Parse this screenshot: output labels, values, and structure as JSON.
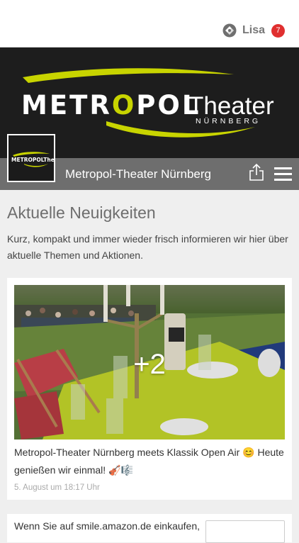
{
  "header": {
    "user_name": "Lisa",
    "notification_count": "7"
  },
  "page": {
    "name": "Metropol-Theater Nürnberg",
    "logo_primary": "METROPOLTheater",
    "logo_metro": "METR",
    "logo_o": "O",
    "logo_pol": "POL",
    "logo_theater": "Theater",
    "logo_city": "NÜRNBERG"
  },
  "section": {
    "title": "Aktuelle Neuigkeiten",
    "description": "Kurz, kompakt und immer wieder frisch informieren wir hier über aktuelle Themen und Aktionen."
  },
  "post": {
    "more_photos": "+2",
    "text": "Metropol-Theater Nürnberg meets Klassik Open Air 😊 Heute genießen wir einmal! 🎻🎼",
    "date": "5. August um 18:17 Uhr"
  },
  "next_post": {
    "text": "Wenn Sie auf smile.amazon.de einkaufen,"
  },
  "colors": {
    "banner_bg": "#1d1d1d",
    "logo_yellow": "#c8d400",
    "page_bar": "#6e6e6e",
    "badge": "#e02f2f"
  },
  "icons": {
    "user": "user-logo-icon",
    "share": "share-icon",
    "menu": "hamburger-menu-icon"
  }
}
